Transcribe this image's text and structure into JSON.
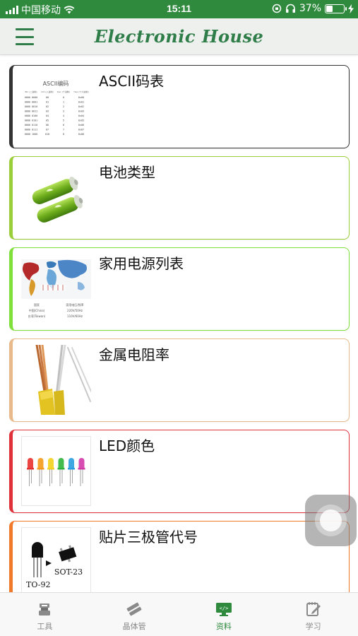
{
  "status_bar": {
    "carrier": "中国移动",
    "time": "15:11",
    "battery_percent": "37%",
    "battery_level": 0.37
  },
  "header": {
    "title": "Electronic House",
    "menu_icon": "hamburger-menu-icon"
  },
  "items": [
    {
      "label": "ASCII码表",
      "accent": "#333333",
      "icon": "ascii-table-thumbnail",
      "thumb_title": "ASCII编码",
      "thumb_headers": [
        "Bin (二进制)",
        "Oct (八进制)",
        "Dec (十进制)",
        "Hex (十六进制)"
      ],
      "thumb_rows": [
        [
          "0000 0000",
          "00",
          "0",
          "0x00"
        ],
        [
          "0000 0001",
          "01",
          "1",
          "0x01"
        ],
        [
          "0000 0010",
          "02",
          "2",
          "0x02"
        ],
        [
          "0000 0011",
          "03",
          "3",
          "0x03"
        ],
        [
          "0000 0100",
          "04",
          "4",
          "0x04"
        ],
        [
          "0000 0101",
          "05",
          "5",
          "0x05"
        ],
        [
          "0000 0110",
          "06",
          "6",
          "0x06"
        ],
        [
          "0000 0111",
          "07",
          "7",
          "0x07"
        ],
        [
          "0000 1000",
          "010",
          "8",
          "0x08"
        ]
      ]
    },
    {
      "label": "电池类型",
      "accent": "#9bcf3a",
      "icon": "battery-thumbnail"
    },
    {
      "label": "家用电源列表",
      "accent": "#7fe03a",
      "icon": "world-power-map-thumbnail",
      "thumb_headers": [
        "国家",
        "家用电压/频率"
      ],
      "thumb_rows": [
        [
          "中国(China)",
          "220V/50Hz"
        ],
        [
          "台湾(Taiwan)",
          "110V/60Hz"
        ]
      ]
    },
    {
      "label": "金属电阻率",
      "accent": "#e8b98a",
      "icon": "copper-wire-thumbnail"
    },
    {
      "label": "LED颜色",
      "accent": "#e0303a",
      "icon": "led-colors-thumbnail"
    },
    {
      "label": "贴片三极管代号",
      "accent": "#f07a2a",
      "icon": "smd-transistor-thumbnail",
      "thumb_labels": [
        "SOT-23",
        "TO-92"
      ]
    }
  ],
  "tabs": [
    {
      "label": "工具",
      "icon": "tools-icon",
      "active": false
    },
    {
      "label": "晶体管",
      "icon": "transistor-icon",
      "active": false
    },
    {
      "label": "资料",
      "icon": "reference-monitor-icon",
      "active": true
    },
    {
      "label": "学习",
      "icon": "study-notebook-icon",
      "active": false
    }
  ],
  "colors": {
    "brand_green": "#2f8a3e",
    "title_green": "#2f7d48",
    "tab_inactive": "#8a8a8a"
  }
}
